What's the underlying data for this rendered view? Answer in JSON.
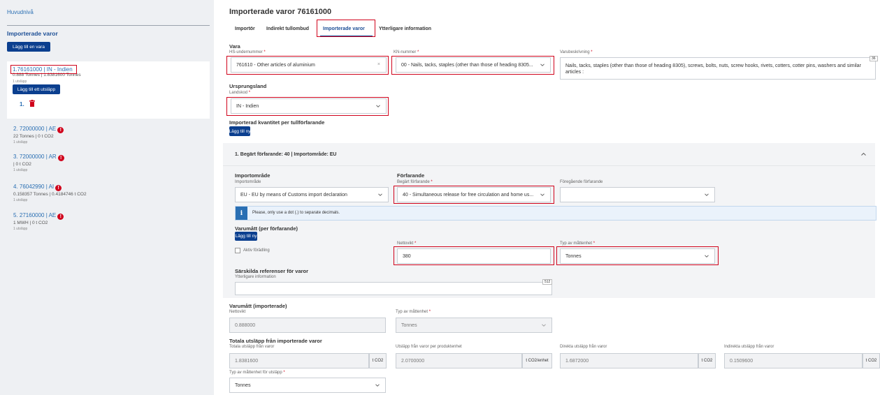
{
  "sidebar": {
    "home_link": "Huvudnivå",
    "title": "Importerade varor",
    "add_item_button": "Lägg till en vara",
    "active_item": {
      "title": "1.76161000 | IN - Indien",
      "sub": "0.888 Tonnes | 1.8381600 Tonnes",
      "tiny": "1 utsläpp",
      "add_emission_button": "Lägg till ett utsläpp",
      "emission_number": "1."
    },
    "items": [
      {
        "title": "2. 72000000 | AE",
        "sub": "22 Tonnes | 0 t CO2",
        "tiny": "1 utsläpp"
      },
      {
        "title": "3. 72000000 | AR",
        "sub": "| 0 t CO2",
        "tiny": "1 utsläpp"
      },
      {
        "title": "4. 76042990 | AI",
        "sub": "0.158357 Tonnes | 0.4184746 t CO2",
        "tiny": "1 utsläpp"
      },
      {
        "title": "5. 27160000 | AE",
        "sub": "1 MWH | 0 t CO2",
        "tiny": "1 utsläpp"
      }
    ],
    "error_glyph": "!"
  },
  "page": {
    "title": "Importerade varor 76161000",
    "tabs": [
      "Importör",
      "Indirekt tullombud",
      "Importerade varor",
      "Ytterligare information"
    ]
  },
  "vara": {
    "heading": "Vara",
    "hs_label": "HS-undernummer",
    "hs_value": "761610 - Other articles of aluminium",
    "kn_label": "KN-nummer",
    "kn_value": "00 - Nails, tacks, staples (other than those of heading 8305...",
    "desc_label": "Varubeskrivning",
    "desc_value": "Nails, tacks, staples (other than those of heading 8305), screws, bolts, nuts, screw hooks, rivets, cotters, cotter pins, washers and similar articles :",
    "desc_counter": "36"
  },
  "origin": {
    "heading": "Ursprungsland",
    "label": "Landskod",
    "value": "IN - Indien"
  },
  "quantity": {
    "heading": "Importerad kvantitet per tullförfarande",
    "add_button": "Lägg till ny"
  },
  "procedure": {
    "panel_title": "1. Begärt förfarande: 40 | Importområde: EU",
    "area_heading": "Importområde",
    "area_label": "Importområde",
    "area_value": "EU - EU by means of Customs import declaration",
    "proc_heading": "Förfarande",
    "proc_label": "Begärt förfarande",
    "proc_value": "40 - Simultaneous release for free circulation and home us...",
    "prev_label": "Föregående förfarande",
    "prev_value": "",
    "info_icon": "i",
    "info_text": "Please, only use a dot (.) to separate decimals.",
    "measure_heading": "Varumått (per förfarande)",
    "measure_add_button": "Lägg till ny",
    "active_refinement": "Aktiv förädling",
    "net_label": "Nettovikt",
    "net_value": "380",
    "unit_label": "Typ av måttenhet",
    "unit_value": "Tonnes",
    "special_heading": "Särskilda referenser för varor",
    "extra_label": "Ytterligare information",
    "extra_value": "",
    "extra_counter": "512"
  },
  "imported_measure": {
    "heading": "Varumått (importerade)",
    "net_label": "Nettovikt",
    "net_value": "0.888000",
    "unit_label": "Typ av måttenhet",
    "unit_value": "Tonnes"
  },
  "emissions": {
    "heading": "Totala utsläpp från importerade varor",
    "total_label": "Totala utsläpp från varor",
    "total_value": "1.8381600",
    "total_unit": "t CO2",
    "per_unit_label": "Utsläpp från varor per produktenhet",
    "per_unit_value": "2.0700000",
    "per_unit_unit": "t CO2/enhet",
    "direct_label": "Direkta utsläpp från varor",
    "direct_value": "1.6872000",
    "direct_unit": "t CO2",
    "indirect_label": "Indirekta utsläpp från varor",
    "indirect_value": "0.1509600",
    "indirect_unit": "t CO2",
    "unit_type_label": "Typ av måttenhet för utsläpp",
    "unit_type_value": "Tonnes"
  },
  "required_mark": "*",
  "clear_glyph": "×",
  "colors": {
    "primary": "#0b3f8f",
    "link": "#2a6fb3",
    "error": "#d0021b",
    "highlight": "#d0021b"
  }
}
